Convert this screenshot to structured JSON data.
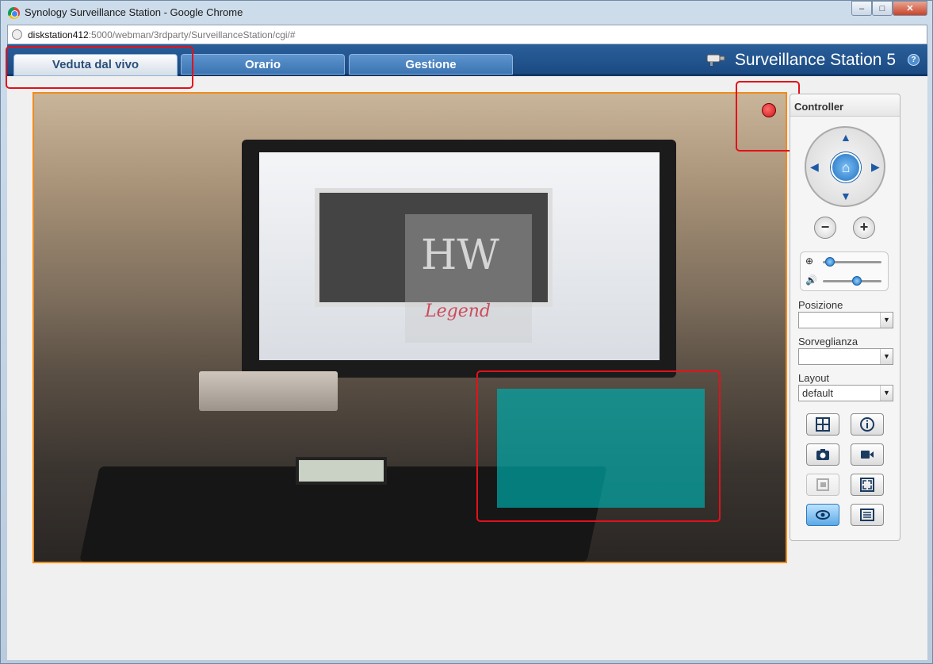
{
  "window": {
    "title": "Synology Surveillance Station - Google Chrome",
    "minimize": "‒",
    "maximize": "□",
    "close": "✕"
  },
  "address": {
    "host": "diskstation412",
    "rest": ":5000/webman/3rdparty/SurveillanceStation/cgi/#"
  },
  "tabs": [
    {
      "label": "Veduta dal vivo",
      "active": true
    },
    {
      "label": "Orario",
      "active": false
    },
    {
      "label": "Gestione",
      "active": false
    }
  ],
  "brand": {
    "title": "Surveillance Station 5",
    "help": "?"
  },
  "video": {
    "watermark_main": "HW",
    "watermark_sub": "Legend",
    "recording": true
  },
  "controller": {
    "title": "Controller",
    "zoom_out": "−",
    "zoom_in": "+",
    "zoom_level": 0.05,
    "volume_level": 0.6,
    "position_label": "Posizione",
    "position_value": "",
    "patrol_label": "Sorveglianza",
    "patrol_value": "",
    "layout_label": "Layout",
    "layout_value": "default"
  },
  "tools": [
    {
      "icon": "layout-grid-icon",
      "state": "normal"
    },
    {
      "icon": "info-icon",
      "state": "normal"
    },
    {
      "icon": "snapshot-camera-icon",
      "state": "normal"
    },
    {
      "icon": "video-record-icon",
      "state": "normal"
    },
    {
      "icon": "snapshot-view-icon",
      "state": "disabled"
    },
    {
      "icon": "fullscreen-icon",
      "state": "normal"
    },
    {
      "icon": "motion-detection-icon",
      "state": "active"
    },
    {
      "icon": "event-list-icon",
      "state": "normal"
    }
  ],
  "colors": {
    "video_border": "#f08c1a",
    "highlight": "#e3111a",
    "motion_area": "#00aaaa",
    "topbar": "#1b4a82"
  }
}
